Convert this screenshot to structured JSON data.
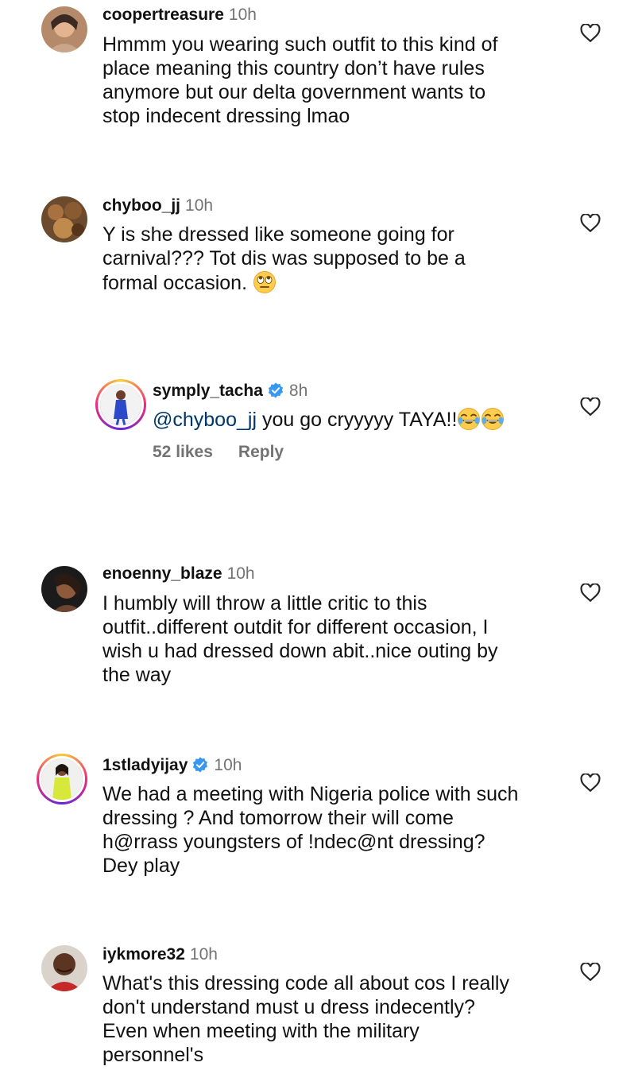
{
  "comments": [
    {
      "username": "coopertreasure",
      "time": "10h",
      "text": "Hmmm you wearing such outfit to this kind of\nplace meaning this country don’t have rules\nanymore but our delta government wants to\nstop indecent dressing lmao"
    },
    {
      "username": "chyboo_jj",
      "time": "10h",
      "text": "Y is she dressed like someone going for\ncarnival??? Tot dis was supposed to be a\nformal occasion. ",
      "emoji": "eye-roll-emoji"
    },
    {
      "username": "symply_tacha",
      "time": "8h",
      "verified": true,
      "mention": "@chyboo_jj",
      "text": " you go cryyyyy TAYA!!",
      "emoji": "tears-of-joy-emoji",
      "likes": "52 likes",
      "reply": "Reply"
    },
    {
      "username": "enoenny_blaze",
      "time": "10h",
      "text": "I humbly will throw a little critic to this\noutfit..different outdit for different occasion, I\nwish  u had dressed down abit..nice outing by\nthe way"
    },
    {
      "username": "1stladyijay",
      "time": "10h",
      "verified": true,
      "text": "We had a meeting with Nigeria police with such\ndressing ? And tomorrow their will come\nh@rrass youngsters of !ndec@nt dressing?\nDey play"
    },
    {
      "username": "iykmore32",
      "time": "10h",
      "text": "What's this dressing code all about cos I really\ndon't understand must u dress indecently?\nEven when meeting with the military\npersonnel's"
    }
  ],
  "colors": {
    "text": "#111111",
    "muted": "#737373",
    "verified": "#3897f0",
    "mention": "#00376b"
  }
}
